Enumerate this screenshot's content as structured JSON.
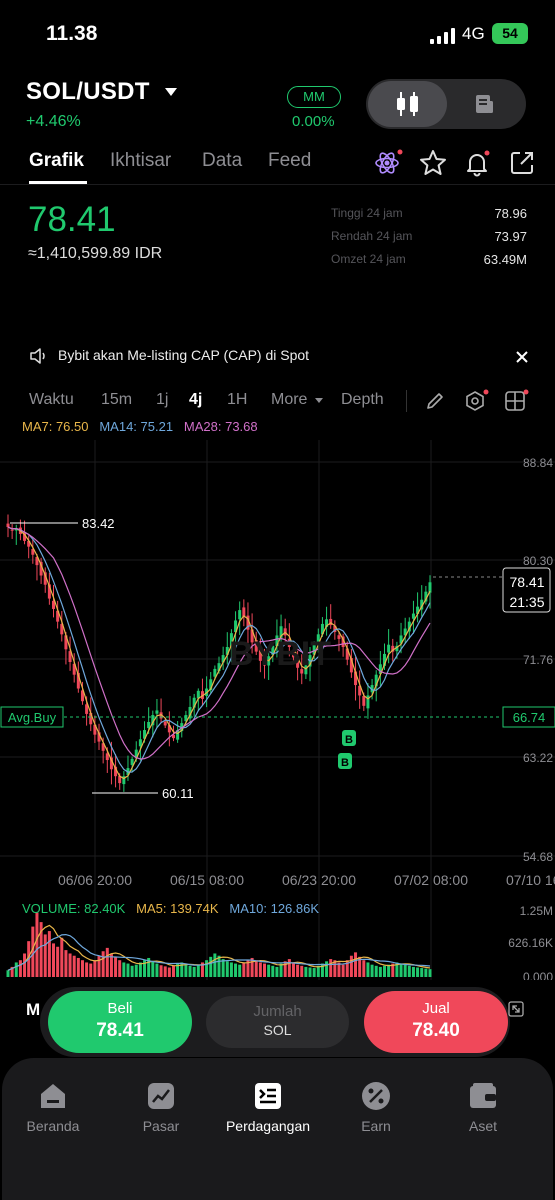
{
  "status_bar": {
    "time": "11.38",
    "network": "4G",
    "battery": "54"
  },
  "header": {
    "pair": "SOL/USDT",
    "change": "+4.46%",
    "mm_label": "MM",
    "mm_value": "0.00%"
  },
  "tabs": [
    {
      "label": "Grafik"
    },
    {
      "label": "Ikhtisar"
    },
    {
      "label": "Data"
    },
    {
      "label": "Feed"
    }
  ],
  "price": {
    "last": "78.41",
    "idr": "≈1,410,599.89 IDR",
    "stats": [
      {
        "label": "Tinggi 24 jam",
        "value": "78.96"
      },
      {
        "label": "Rendah 24 jam",
        "value": "73.97"
      },
      {
        "label": "Omzet 24 jam",
        "value": "63.49M"
      }
    ]
  },
  "announcement": {
    "text": "Bybit  akan Me-listing CAP  (CAP) di Spot"
  },
  "timeframes": [
    {
      "label": "Waktu"
    },
    {
      "label": "15m"
    },
    {
      "label": "1j"
    },
    {
      "label": "4j"
    },
    {
      "label": "1H"
    },
    {
      "label": "More"
    },
    {
      "label": "Depth"
    }
  ],
  "ma_legend": {
    "ma7": "MA7: 76.50",
    "ma14": "MA14: 75.21",
    "ma28": "MA28: 73.68"
  },
  "colors": {
    "up": "#20c96e",
    "down": "#f0485a",
    "ma7": "#e8b64a",
    "ma14": "#6fa8dc",
    "ma28": "#d070c8",
    "vol": "#e8b64a"
  },
  "chart_data": {
    "type": "candlestick",
    "y_ticks": [
      "88.84",
      "80.30",
      "71.76",
      "63.22",
      "54.68"
    ],
    "x_ticks": [
      "06/06 20:00",
      "06/15 08:00",
      "06/23 20:00",
      "07/02 08:00",
      "07/10 16"
    ],
    "ylim": [
      54.68,
      88.84
    ],
    "high_marker": "83.42",
    "low_marker": "60.11",
    "current_price": "78.41",
    "countdown": "21:35",
    "avg_buy_label": "Avg.Buy",
    "avg_buy_value": "66.74",
    "buy_markers": [
      "B",
      "B"
    ],
    "close_series": [
      83.2,
      82.9,
      83.1,
      82.6,
      82.0,
      81.5,
      80.8,
      79.9,
      79.0,
      78.2,
      77.0,
      76.1,
      75.0,
      73.9,
      72.6,
      71.5,
      70.4,
      69.2,
      68.1,
      67.0,
      66.1,
      65.2,
      64.6,
      63.8,
      63.0,
      62.2,
      61.6,
      61.0,
      61.6,
      62.3,
      63.1,
      63.9,
      64.8,
      65.6,
      66.3,
      66.9,
      67.3,
      66.6,
      66.0,
      65.4,
      64.9,
      65.6,
      66.2,
      66.9,
      67.6,
      68.4,
      69.0,
      68.3,
      69.2,
      70.0,
      70.9,
      71.4,
      72.1,
      72.8,
      74.0,
      75.1,
      76.0,
      75.4,
      74.3,
      73.2,
      72.4,
      71.6,
      71.2,
      72.0,
      72.9,
      73.8,
      74.6,
      73.8,
      72.8,
      71.9,
      71.0,
      70.5,
      71.2,
      72.1,
      73.0,
      73.9,
      74.8,
      75.2,
      74.7,
      74.1,
      73.5,
      72.8,
      71.7,
      70.6,
      69.5,
      68.6,
      67.7,
      68.6,
      69.5,
      70.4,
      71.3,
      72.2,
      73.0,
      72.4,
      72.9,
      73.8,
      74.4,
      75.0,
      75.7,
      76.3,
      76.9,
      77.6,
      78.41
    ],
    "volume": {
      "label": "VOLUME: 82.40K",
      "ma5": "MA5: 139.74K",
      "ma10": "MA10: 126.86K",
      "y_ticks": [
        "1.25M",
        "626.16K",
        "0.000"
      ],
      "values": [
        120,
        180,
        260,
        300,
        420,
        640,
        900,
        1150,
        980,
        760,
        820,
        600,
        540,
        700,
        480,
        420,
        380,
        340,
        300,
        260,
        240,
        300,
        380,
        460,
        520,
        420,
        360,
        300,
        260,
        240,
        200,
        220,
        260,
        300,
        340,
        280,
        240,
        210,
        190,
        170,
        200,
        240,
        260,
        230,
        200,
        180,
        220,
        260,
        300,
        360,
        420,
        380,
        320,
        280,
        260,
        240,
        220,
        260,
        300,
        340,
        300,
        260,
        240,
        220,
        200,
        180,
        240,
        280,
        320,
        260,
        220,
        200,
        180,
        170,
        160,
        200,
        240,
        280,
        320,
        300,
        260,
        220,
        300,
        380,
        440,
        360,
        300,
        260,
        220,
        200,
        180,
        200,
        220,
        240,
        260,
        240,
        220,
        200,
        180,
        170,
        160,
        150,
        140
      ]
    }
  },
  "trade": {
    "m_label": "M",
    "buy_label": "Beli",
    "buy_price": "78.41",
    "amount_placeholder": "Jumlah",
    "amount_unit": "SOL",
    "sell_label": "Jual",
    "sell_price": "78.40"
  },
  "bottom_nav": [
    {
      "label": "Beranda",
      "icon": "home-icon"
    },
    {
      "label": "Pasar",
      "icon": "market-icon"
    },
    {
      "label": "Perdagangan",
      "icon": "trade-icon"
    },
    {
      "label": "Earn",
      "icon": "earn-icon"
    },
    {
      "label": "Aset",
      "icon": "wallet-icon"
    }
  ]
}
